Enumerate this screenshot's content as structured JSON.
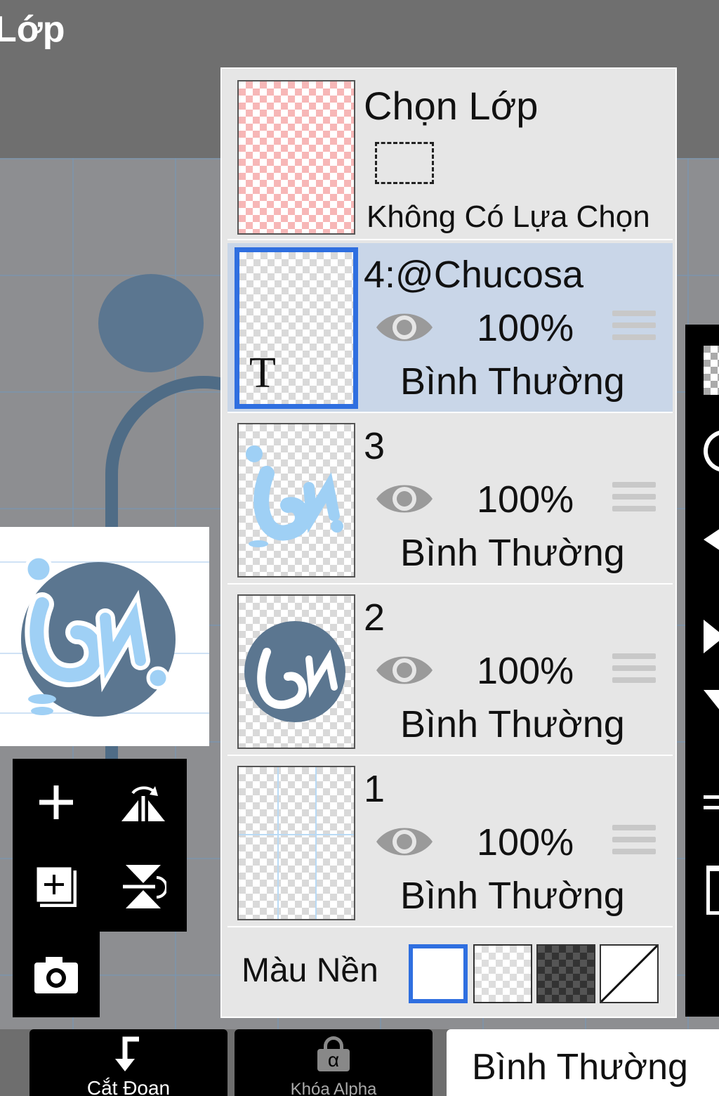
{
  "header": {
    "title": "Lớp"
  },
  "selection_row": {
    "title": "Chọn Lớp",
    "subtitle": "Không Có Lựa Chọn"
  },
  "layers": [
    {
      "name": "4:@Chucosa",
      "opacity": "100%",
      "blend": "Bình Thường",
      "selected": true
    },
    {
      "name": "3",
      "opacity": "100%",
      "blend": "Bình Thường",
      "selected": false
    },
    {
      "name": "2",
      "opacity": "100%",
      "blend": "Bình Thường",
      "selected": false
    },
    {
      "name": "1",
      "opacity": "100%",
      "blend": "Bình Thường",
      "selected": false
    }
  ],
  "text_layer_glyph": "T",
  "background": {
    "label": "Màu Nền",
    "options": [
      "white",
      "transparent",
      "dark-checker",
      "none"
    ],
    "selected": "white"
  },
  "bottom": {
    "clip_label": "Cắt Đoạn",
    "alpha_lock_label": "Khóa Alpha",
    "alpha_glyph": "α",
    "blend_mode": "Bình Thường"
  },
  "colors": {
    "accent": "#2f6fe0",
    "selected_row": "#c9d6e8",
    "art_blue": "#5b7690",
    "art_light_blue": "#9fd0f5"
  }
}
